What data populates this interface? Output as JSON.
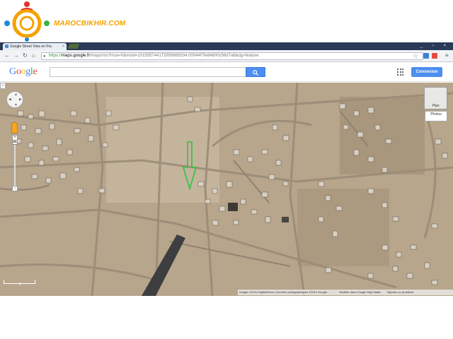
{
  "watermark": {
    "text": "MAROCBIKHIR.COM"
  },
  "browser": {
    "tab_title": "Google Street View en Fra",
    "tab_close": "×",
    "window_controls": "_ ▫ ×",
    "url_scheme": "https://",
    "url_host": "maps.google.fr",
    "url_path": "/maps/ms?msa=0&msid=101555744172859669534.00044f7fe84800c56d7a6&dg=feature",
    "icons": [
      "back-icon",
      "forward-icon",
      "reload-icon",
      "home-icon",
      "lock-icon",
      "star-icon",
      "menu-icon"
    ]
  },
  "header": {
    "logo": "Google",
    "search_placeholder": "",
    "sign_in": "Connexion"
  },
  "map": {
    "map_type_label": "Plan",
    "photos_label": "Photos",
    "layer_toggle": "»",
    "zoom_in": "+",
    "zoom_out": "−",
    "attribution": "Images ©2014 DigitalGlobe, Données cartographiques ©2014 Google",
    "attribution_sep": "-",
    "edit_link": "Modifier dans Google Map Maker",
    "report_link": "Signaler un problème",
    "marker_color": "#3cc24a"
  },
  "colors": {
    "tabbar": "#2a3a57",
    "accent": "#4d8ef0",
    "terrain": "#b5a28a"
  }
}
